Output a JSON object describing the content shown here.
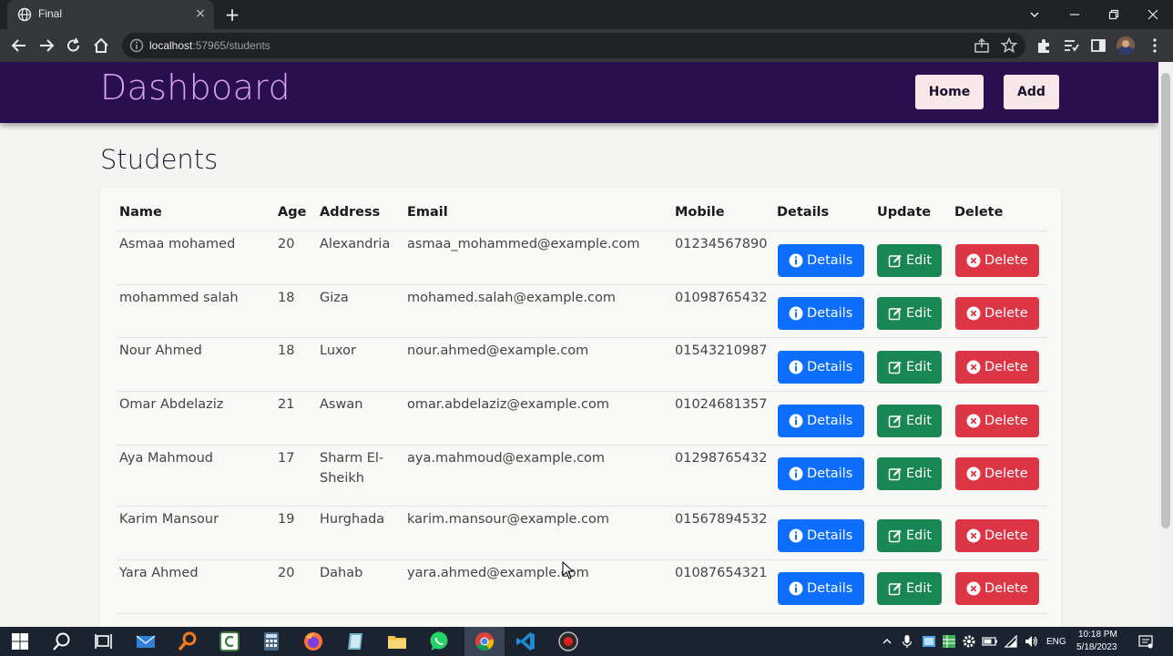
{
  "browser": {
    "tab_title": "Final",
    "url_host": "localhost",
    "url_path": ":57965/students",
    "new_tab_symbol": "+",
    "close_symbol": "×"
  },
  "navbar": {
    "brand": "Dashboard",
    "links": [
      "Home",
      "Add"
    ]
  },
  "page": {
    "title": "Students"
  },
  "table": {
    "headers": [
      "Name",
      "Age",
      "Address",
      "Email",
      "Mobile",
      "Details",
      "Update",
      "Delete"
    ],
    "button_labels": {
      "details": "Details",
      "edit": "Edit",
      "delete": "Delete"
    },
    "rows": [
      {
        "name": "Asmaa mohamed",
        "age": "20",
        "address": "Alexandria",
        "email": "asmaa_mohammed@example.com",
        "mobile": "01234567890"
      },
      {
        "name": "mohammed salah",
        "age": "18",
        "address": "Giza",
        "email": "mohamed.salah@example.com",
        "mobile": "01098765432"
      },
      {
        "name": "Nour Ahmed",
        "age": "18",
        "address": "Luxor",
        "email": "nour.ahmed@example.com",
        "mobile": "01543210987"
      },
      {
        "name": "Omar Abdelaziz",
        "age": "21",
        "address": "Aswan",
        "email": "omar.abdelaziz@example.com",
        "mobile": "01024681357"
      },
      {
        "name": "Aya Mahmoud",
        "age": "17",
        "address": "Sharm El-Sheikh",
        "email": "aya.mahmoud@example.com",
        "mobile": "01298765432"
      },
      {
        "name": "Karim Mansour",
        "age": "19",
        "address": "Hurghada",
        "email": "karim.mansour@example.com",
        "mobile": "01567894532"
      },
      {
        "name": "Yara Ahmed",
        "age": "20",
        "address": "Dahab",
        "email": "yara.ahmed@example.com",
        "mobile": "01087654321"
      }
    ]
  },
  "taskbar": {
    "language": "ENG",
    "time": "10:18 PM",
    "date": "5/18/2023"
  },
  "colors": {
    "navbar_bg": "#2a0f4e",
    "brand": "#d9a2f2",
    "details_btn": "#0d6efd",
    "edit_btn": "#198754",
    "delete_btn": "#dc3545"
  }
}
